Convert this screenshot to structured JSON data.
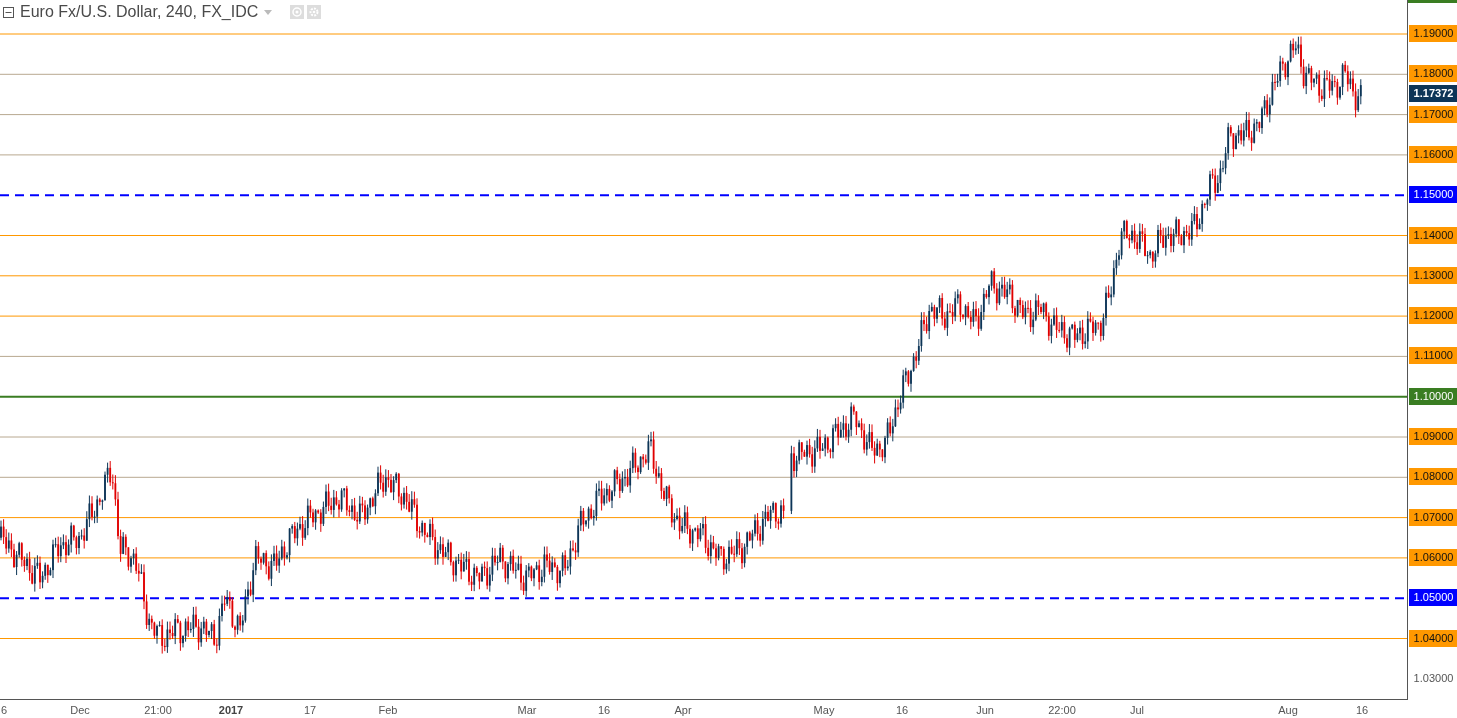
{
  "header": {
    "title": "Euro Fx/U.S. Dollar, 240, FX_IDC"
  },
  "price_levels": [
    {
      "label": "1.19000",
      "kind": "level",
      "color": "#ff9800"
    },
    {
      "label": "1.18000",
      "kind": "grid",
      "color": "#ff9800"
    },
    {
      "label": "1.17000",
      "kind": "grid",
      "color": "#ff9800"
    },
    {
      "label": "1.16000",
      "kind": "grid",
      "color": "#ff9800"
    },
    {
      "label": "1.15000",
      "kind": "dashed",
      "color": "#0000ff"
    },
    {
      "label": "1.14000",
      "kind": "level",
      "color": "#ff9800"
    },
    {
      "label": "1.13000",
      "kind": "level",
      "color": "#ff9800"
    },
    {
      "label": "1.12000",
      "kind": "level",
      "color": "#ff9800"
    },
    {
      "label": "1.11000",
      "kind": "grid",
      "color": "#ff9800"
    },
    {
      "label": "1.10000",
      "kind": "major",
      "color": "#3a7d22"
    },
    {
      "label": "1.09000",
      "kind": "grid",
      "color": "#ff9800"
    },
    {
      "label": "1.08000",
      "kind": "grid",
      "color": "#ff9800"
    },
    {
      "label": "1.07000",
      "kind": "level",
      "color": "#ff9800"
    },
    {
      "label": "1.06000",
      "kind": "level",
      "color": "#ff9800"
    },
    {
      "label": "1.05000",
      "kind": "dashed",
      "color": "#0000ff"
    },
    {
      "label": "1.04000",
      "kind": "level",
      "color": "#ff9800"
    },
    {
      "label": "1.03000",
      "kind": "tick"
    }
  ],
  "current_price": {
    "label": "1.17372",
    "color": "#0d3557"
  },
  "time_axis": [
    {
      "label": "6",
      "bold": false
    },
    {
      "label": "Dec",
      "bold": false
    },
    {
      "label": "21:00",
      "bold": false
    },
    {
      "label": "2017",
      "bold": true
    },
    {
      "label": "17",
      "bold": false
    },
    {
      "label": "Feb",
      "bold": false
    },
    {
      "label": "Mar",
      "bold": false
    },
    {
      "label": "16",
      "bold": false
    },
    {
      "label": "Apr",
      "bold": false
    },
    {
      "label": "May",
      "bold": false
    },
    {
      "label": "16",
      "bold": false
    },
    {
      "label": "Jun",
      "bold": false
    },
    {
      "label": "22:00",
      "bold": false
    },
    {
      "label": "Jul",
      "bold": false
    },
    {
      "label": "Aug",
      "bold": false
    },
    {
      "label": "16",
      "bold": false
    }
  ]
}
